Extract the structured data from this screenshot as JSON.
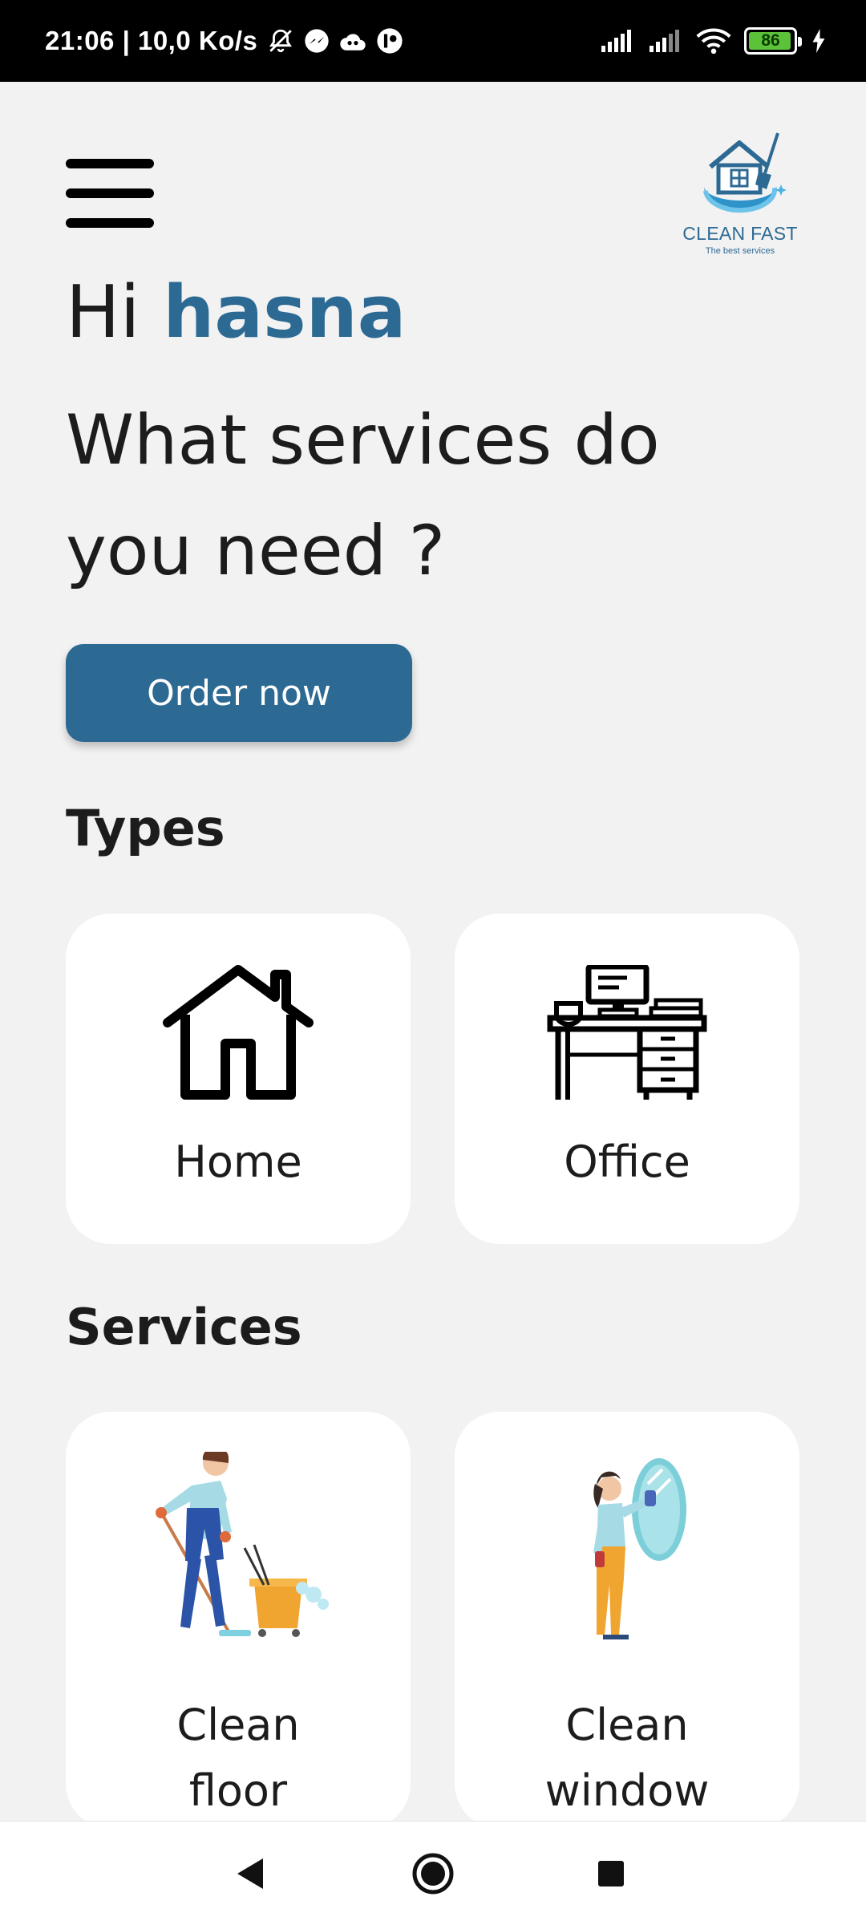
{
  "status_bar": {
    "time": "21:06 | 10,0 Ko/s",
    "battery": "86",
    "icons": [
      "bell-off-icon",
      "messenger-icon",
      "cloud-icon",
      "app-icon",
      "signal-icon",
      "signal-icon",
      "wifi-icon",
      "battery-icon",
      "charging-icon"
    ]
  },
  "header": {
    "menu_icon": "hamburger-menu-icon",
    "logo_name": "CLEAN FAST",
    "logo_tagline": "The best services"
  },
  "greeting": {
    "hi": "Hi",
    "name": "hasna",
    "question": "What services do you need ?"
  },
  "order_button": "Order now",
  "types": {
    "title": "Types",
    "items": [
      {
        "label": "Home",
        "icon": "house-icon"
      },
      {
        "label": "Office",
        "icon": "office-desk-icon"
      }
    ]
  },
  "services": {
    "title": "Services",
    "items": [
      {
        "label": "Clean floor",
        "icon": "floor-cleaning-illustration"
      },
      {
        "label": "Clean window",
        "icon": "window-cleaning-illustration"
      }
    ]
  },
  "navbar": {
    "back_icon": "back-triangle-icon",
    "home_icon": "home-circle-icon",
    "recent_icon": "recent-apps-square-icon"
  },
  "colors": {
    "accent": "#2d6a93",
    "background": "#f2f2f2",
    "card": "#ffffff"
  }
}
